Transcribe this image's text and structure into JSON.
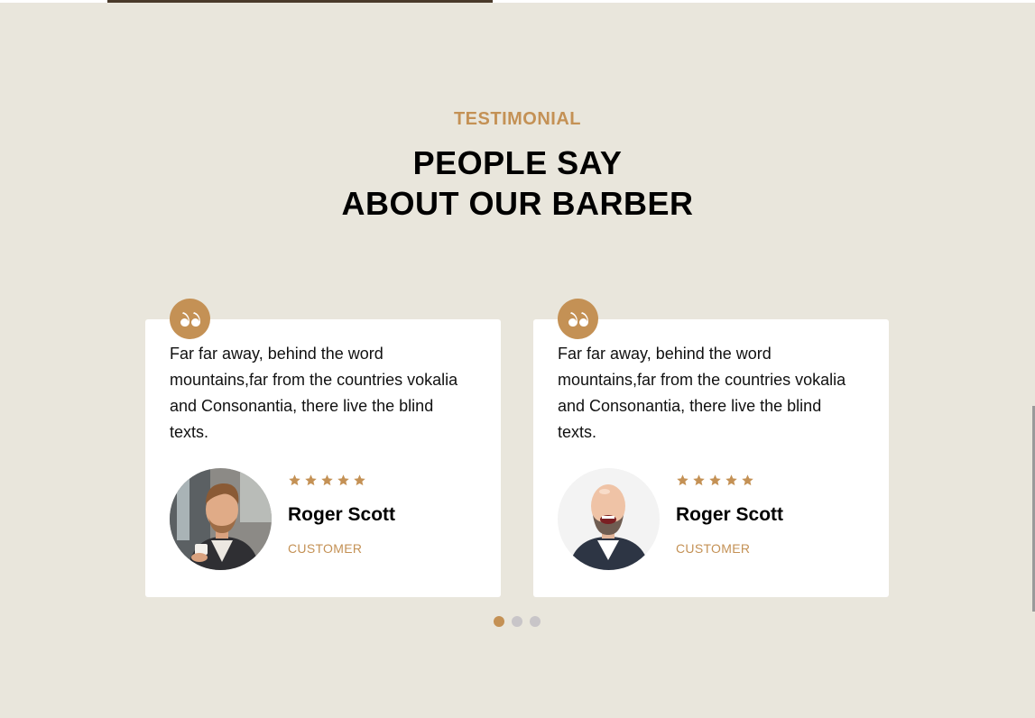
{
  "section": {
    "subheading": "TESTIMONIAL",
    "heading_line1": "PEOPLE SAY",
    "heading_line2": "ABOUT OUR BARBER"
  },
  "testimonials": [
    {
      "quote": "Far far away, behind the word mountains,far from the countries vokalia and Consonantia, there live the blind texts.",
      "name": "Roger Scott",
      "role": "CUSTOMER",
      "rating": 5,
      "avatar_icon": "man-with-coffee-portrait"
    },
    {
      "quote": "Far far away, behind the word mountains,far from the countries vokalia and Consonantia, there live the blind texts.",
      "name": "Roger Scott",
      "role": "CUSTOMER",
      "rating": 5,
      "avatar_icon": "bald-man-laughing-portrait"
    }
  ],
  "pagination": {
    "count": 3,
    "active_index": 0
  },
  "colors": {
    "accent": "#c49155",
    "background": "#e9e6dc",
    "card": "#ffffff",
    "dot_inactive": "#c8c5c8"
  }
}
